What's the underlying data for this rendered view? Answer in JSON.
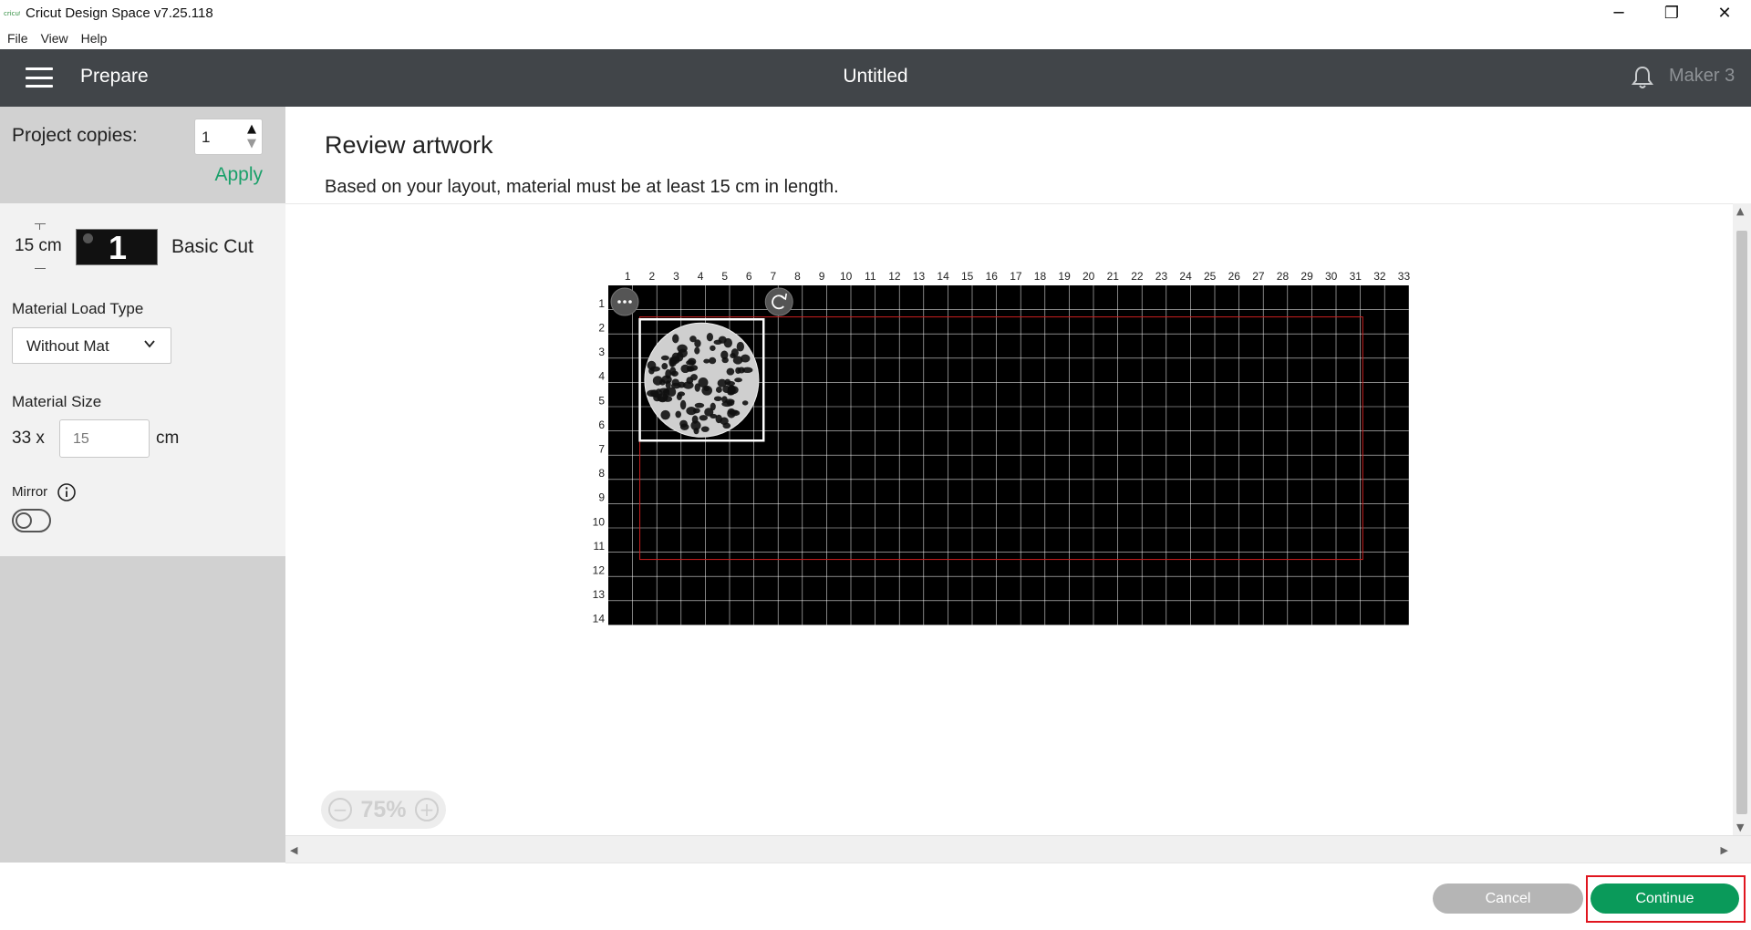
{
  "window": {
    "app_icon_text": "cricut",
    "title": "Cricut Design Space  v7.25.118",
    "minimize_glyph": "─",
    "restore_glyph": "❐",
    "close_glyph": "✕"
  },
  "menu": {
    "items": [
      {
        "label": "File"
      },
      {
        "label": "View"
      },
      {
        "label": "Help"
      }
    ]
  },
  "header": {
    "section": "Prepare",
    "project_title": "Untitled",
    "machine": "Maker 3",
    "bell_icon": "bell-icon",
    "menu_icon": "hamburger-menu-icon"
  },
  "left_panel": {
    "copies_label": "Project copies:",
    "copies_value": "1",
    "apply_label": "Apply",
    "mat_length": "15 cm",
    "mat_number": "1",
    "mat_name": "Basic Cut",
    "load_type_label": "Material Load Type",
    "load_type_value": "Without Mat",
    "size_label": "Material Size",
    "size_width": "33 x",
    "size_length_value": "15",
    "size_unit": "cm",
    "mirror_label": "Mirror",
    "mirror_on": false
  },
  "main": {
    "title": "Review artwork",
    "subtitle": "Based on your layout, material must be at least 15 cm in length.",
    "zoom_level": "75%",
    "zoom_out_glyph": "−",
    "zoom_in_glyph": "+",
    "mat_grid": {
      "columns": 33,
      "rows": 14,
      "column_labels": [
        "1",
        "2",
        "3",
        "4",
        "5",
        "6",
        "7",
        "8",
        "9",
        "10",
        "11",
        "12",
        "13",
        "14",
        "15",
        "16",
        "17",
        "18",
        "19",
        "20",
        "21",
        "22",
        "23",
        "24",
        "25",
        "26",
        "27",
        "28",
        "29",
        "30",
        "31",
        "32",
        "33"
      ],
      "row_labels": [
        "1",
        "2",
        "3",
        "4",
        "5",
        "6",
        "7",
        "8",
        "9",
        "10",
        "11",
        "12",
        "13",
        "14"
      ],
      "background_color": "#000000",
      "grid_color": "#ffffff",
      "cut_boundary_color": "#cc1f1f"
    }
  },
  "footer": {
    "cancel_label": "Cancel",
    "continue_label": "Continue",
    "continue_color": "#0a9a5a",
    "highlight_color": "#e0151f"
  }
}
